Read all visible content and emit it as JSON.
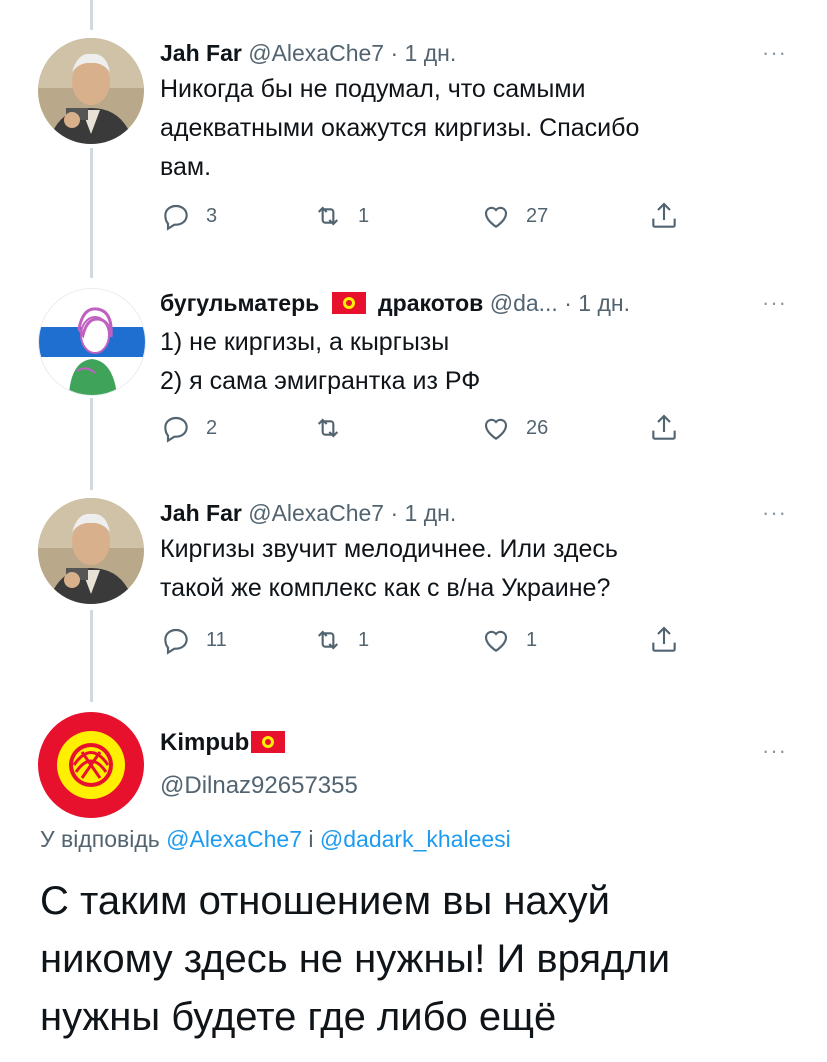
{
  "tweets": [
    {
      "name": "Jah Far",
      "handle": "@AlexaChe7",
      "sep": "·",
      "time": "1 дн.",
      "text_lines": [
        "Никогда бы не подумал, что самыми",
        "адекватными окажутся киргизы. Спасибо",
        "вам."
      ],
      "replies": "3",
      "retweets": "1",
      "likes": "27"
    },
    {
      "name": "бугульматерь",
      "name2": "дракотов",
      "handle": "@da...",
      "sep": "·",
      "time": "1 дн.",
      "text_lines": [
        "1) не киргизы, а кыргызы",
        "2) я сама эмигрантка из РФ"
      ],
      "replies": "2",
      "retweets": "",
      "likes": "26"
    },
    {
      "name": "Jah Far",
      "handle": "@AlexaChe7",
      "sep": "·",
      "time": "1 дн.",
      "text_lines": [
        "Киргизы звучит мелодичнее.  Или здесь",
        "такой же комплекс как с в/на Украине?"
      ],
      "replies": "11",
      "retweets": "1",
      "likes": "1"
    }
  ],
  "main_tweet": {
    "name": "Kimpub",
    "handle": "@Dilnaz92657355",
    "reply_prefix": "У відповідь",
    "reply_user1": "@AlexaChe7",
    "reply_conj": "і",
    "reply_user2": "@dadark_khaleesi",
    "text_lines": [
      "С таким отношением вы нахуй",
      "никому здесь не нужны! И врядли",
      "нужны будете где либо ещё"
    ]
  },
  "more_label": "···",
  "colors": {
    "accent": "#1d9bf0",
    "muted": "#536471",
    "thread": "#cfd9de",
    "kg_red": "#e8112d",
    "kg_sun": "#ffef00"
  }
}
